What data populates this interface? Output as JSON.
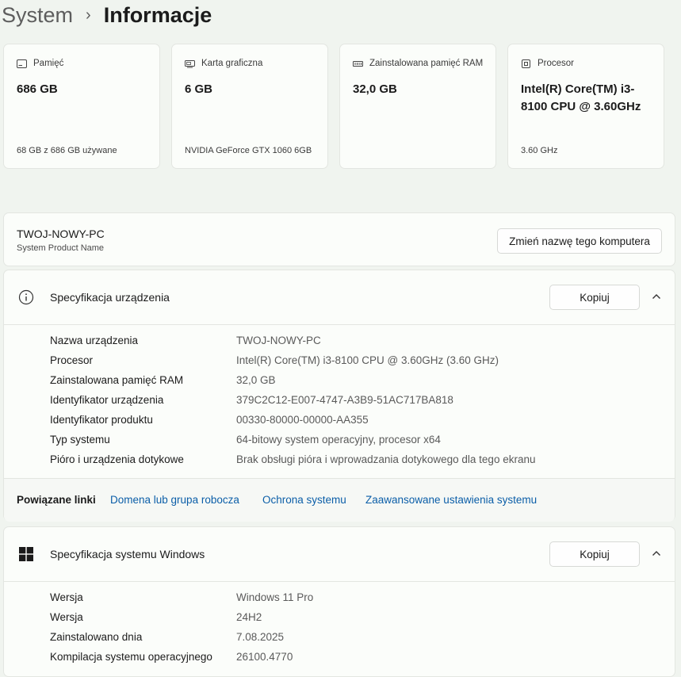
{
  "breadcrumb": {
    "parent": "System",
    "separator": "›",
    "current": "Informacje"
  },
  "cards": [
    {
      "icon": "storage-icon",
      "label": "Pamięć",
      "value": "686 GB",
      "sub": "68 GB z 686 GB używane"
    },
    {
      "icon": "gpu-icon",
      "label": "Karta graficzna",
      "value": "6 GB",
      "sub": "NVIDIA GeForce GTX 1060 6GB"
    },
    {
      "icon": "ram-icon",
      "label": "Zainstalowana pamięć RAM",
      "value": "32,0 GB",
      "sub": ""
    },
    {
      "icon": "processor-icon",
      "label": "Procesor",
      "value": "Intel(R) Core(TM) i3-8100 CPU @ 3.60GHz",
      "sub": "3.60 GHz"
    }
  ],
  "pc": {
    "name": "TWOJ-NOWY-PC",
    "model": "System Product Name",
    "rename_button": "Zmień nazwę tego komputera"
  },
  "device_spec": {
    "title": "Specyfikacja urządzenia",
    "copy_button": "Kopiuj",
    "rows": [
      {
        "key": "Nazwa urządzenia",
        "value": "TWOJ-NOWY-PC"
      },
      {
        "key": "Procesor",
        "value": "Intel(R) Core(TM) i3-8100 CPU @ 3.60GHz (3.60 GHz)"
      },
      {
        "key": "Zainstalowana pamięć RAM",
        "value": "32,0 GB"
      },
      {
        "key": "Identyfikator urządzenia",
        "value": "379C2C12-E007-4747-A3B9-51AC717BA818"
      },
      {
        "key": "Identyfikator produktu",
        "value": "00330-80000-00000-AA355"
      },
      {
        "key": "Typ systemu",
        "value": "64-bitowy system operacyjny, procesor x64"
      },
      {
        "key": "Pióro i urządzenia dotykowe",
        "value": "Brak obsługi pióra i wprowadzania dotykowego dla tego ekranu"
      }
    ]
  },
  "related_links": {
    "label": "Powiązane linki",
    "links": [
      "Domena lub grupa robocza",
      "Ochrona systemu",
      "Zaawansowane ustawienia systemu"
    ]
  },
  "windows_spec": {
    "title": "Specyfikacja systemu Windows",
    "copy_button": "Kopiuj",
    "rows": [
      {
        "key": "Wersja",
        "value": "Windows 11 Pro"
      },
      {
        "key": "Wersja",
        "value": "24H2"
      },
      {
        "key": "Zainstalowano dnia",
        "value": "7.08.2025"
      },
      {
        "key": "Kompilacja systemu operacyjnego",
        "value": "26100.4770"
      }
    ]
  },
  "colors": {
    "accent": "#0b5ea8",
    "background": "#f0f4ef",
    "card": "#fbfdfa"
  }
}
